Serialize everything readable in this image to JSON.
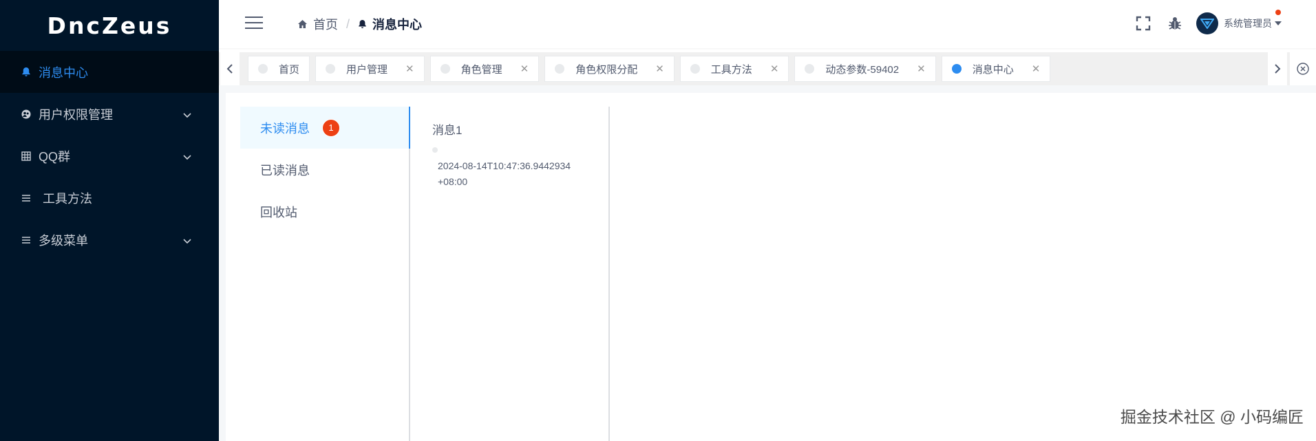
{
  "app": {
    "logo": "DncZeus"
  },
  "sidebar": {
    "items": [
      {
        "label": "消息中心",
        "icon": "bell-icon",
        "active": true,
        "expandable": false
      },
      {
        "label": "用户权限管理",
        "icon": "user-group-icon",
        "active": false,
        "expandable": true
      },
      {
        "label": "QQ群",
        "icon": "grid-icon",
        "active": false,
        "expandable": true
      },
      {
        "label": "工具方法",
        "icon": "list-icon",
        "active": false,
        "expandable": false
      },
      {
        "label": "多级菜单",
        "icon": "list-icon",
        "active": false,
        "expandable": true
      }
    ]
  },
  "header": {
    "breadcrumb": [
      {
        "label": "首页",
        "icon": "home-icon"
      },
      {
        "label": "消息中心",
        "icon": "bell-icon"
      }
    ],
    "user": {
      "name": "系统管理员"
    }
  },
  "tags": [
    {
      "label": "首页",
      "closable": false,
      "active": false
    },
    {
      "label": "用户管理",
      "closable": true,
      "active": false
    },
    {
      "label": "角色管理",
      "closable": true,
      "active": false
    },
    {
      "label": "角色权限分配",
      "closable": true,
      "active": false
    },
    {
      "label": "工具方法",
      "closable": true,
      "active": false
    },
    {
      "label": "动态参数-59402",
      "closable": true,
      "active": false
    },
    {
      "label": "消息中心",
      "closable": true,
      "active": true
    }
  ],
  "message_center": {
    "menu": [
      {
        "label": "未读消息",
        "badge": "1",
        "active": true
      },
      {
        "label": "已读消息",
        "active": false
      },
      {
        "label": "回收站",
        "active": false
      }
    ],
    "messages": [
      {
        "title": "消息1",
        "time": "2024-08-14T10:47:36.9442934+08:00"
      }
    ]
  },
  "watermark": "掘金技术社区 @ 小码编匠",
  "colors": {
    "sidebar_bg": "#001529",
    "accent": "#2d8cf0",
    "badge": "#ed4014"
  }
}
